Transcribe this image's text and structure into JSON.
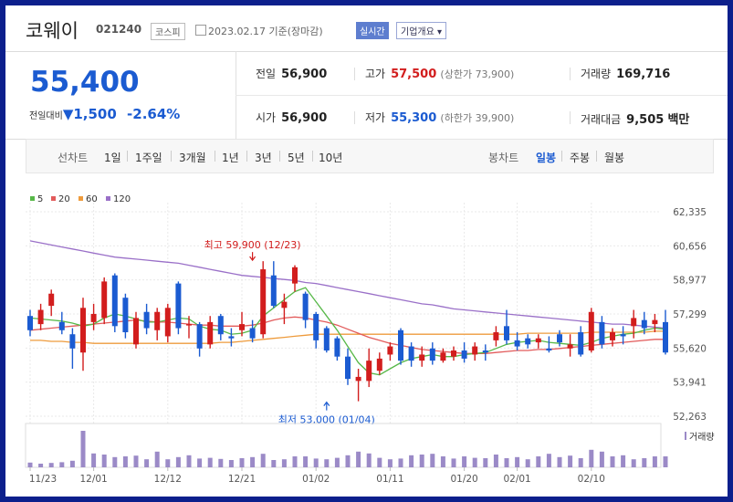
{
  "header": {
    "name": "코웨이",
    "code": "021240",
    "market": "코스피",
    "date": "2023.02.17 기준(장마감)",
    "realtime": "실시간",
    "overview": "기업개요"
  },
  "quote": {
    "price": "55,400",
    "change_label": "전일대비",
    "change": "1,500",
    "change_pct": "-2.64%",
    "prev_close": {
      "label": "전일",
      "value": "56,900"
    },
    "high": {
      "label": "고가",
      "value": "57,500",
      "limit_label": "(상한가",
      "limit_value": "73,900)"
    },
    "volume": {
      "label": "거래량",
      "value": "169,716"
    },
    "open": {
      "label": "시가",
      "value": "56,900"
    },
    "low": {
      "label": "저가",
      "value": "55,300",
      "limit_label": "(하한가",
      "limit_value": "39,900)"
    },
    "amount": {
      "label": "거래대금",
      "value": "9,505",
      "unit": "백만"
    }
  },
  "tabs": {
    "line_label": "선차트",
    "periods": [
      "1일",
      "1주일",
      "3개월",
      "1년",
      "3년",
      "5년",
      "10년"
    ],
    "candle_label": "봉차트",
    "candles": [
      "일봉",
      "주봉",
      "월봉"
    ],
    "active_candle": 0
  },
  "colors": {
    "up": "#d21d1d",
    "down": "#1b5bd1",
    "ma5": "#57b848",
    "ma20": "#e25b5b",
    "ma60": "#ee9b3c",
    "ma120": "#9a70c8",
    "volume": "#9b8ac7"
  },
  "chart_data": {
    "type": "candlestick",
    "legend": [
      {
        "name": "5",
        "color": "#57b848"
      },
      {
        "name": "20",
        "color": "#e25b5b"
      },
      {
        "name": "60",
        "color": "#ee9b3c"
      },
      {
        "name": "120",
        "color": "#9a70c8"
      }
    ],
    "y_ticks": [
      "62,335",
      "60,656",
      "58,977",
      "57,299",
      "55,620",
      "53,941",
      "52,263"
    ],
    "ylim": [
      52263,
      62335
    ],
    "x_ticks": [
      {
        "label": "11/23",
        "index": 0
      },
      {
        "label": "12/01",
        "index": 6
      },
      {
        "label": "12/12",
        "index": 13
      },
      {
        "label": "12/21",
        "index": 20
      },
      {
        "label": "01/02",
        "index": 27
      },
      {
        "label": "01/11",
        "index": 34
      },
      {
        "label": "01/20",
        "index": 41
      },
      {
        "label": "02/01",
        "index": 46
      },
      {
        "label": "02/10",
        "index": 53
      }
    ],
    "annotations": {
      "high": {
        "text": "최고 59,900 (12/23)",
        "index": 21,
        "value": 59900
      },
      "low": {
        "text": "최저 53,000 (01/04)",
        "index": 28,
        "value": 53000
      }
    },
    "volume_label": "거래량",
    "candles": [
      {
        "o": 57200,
        "h": 57500,
        "l": 56200,
        "c": 56500
      },
      {
        "o": 56800,
        "h": 57800,
        "l": 56500,
        "c": 57500
      },
      {
        "o": 57700,
        "h": 58500,
        "l": 57200,
        "c": 58300
      },
      {
        "o": 56900,
        "h": 57400,
        "l": 56300,
        "c": 56500
      },
      {
        "o": 56300,
        "h": 56600,
        "l": 54600,
        "c": 55600
      },
      {
        "o": 55400,
        "h": 58100,
        "l": 54500,
        "c": 57600
      },
      {
        "o": 56900,
        "h": 57800,
        "l": 56500,
        "c": 57300
      },
      {
        "o": 57100,
        "h": 59100,
        "l": 56800,
        "c": 58900
      },
      {
        "o": 59200,
        "h": 59300,
        "l": 56400,
        "c": 56700
      },
      {
        "o": 58100,
        "h": 58300,
        "l": 56100,
        "c": 56400
      },
      {
        "o": 55800,
        "h": 57400,
        "l": 55600,
        "c": 57100
      },
      {
        "o": 57400,
        "h": 57800,
        "l": 56300,
        "c": 56600
      },
      {
        "o": 56500,
        "h": 57600,
        "l": 56000,
        "c": 57400
      },
      {
        "o": 56200,
        "h": 57800,
        "l": 55900,
        "c": 57600
      },
      {
        "o": 58800,
        "h": 58900,
        "l": 56300,
        "c": 56600
      },
      {
        "o": 56800,
        "h": 57200,
        "l": 56100,
        "c": 56800
      },
      {
        "o": 56800,
        "h": 56900,
        "l": 55200,
        "c": 55600
      },
      {
        "o": 55800,
        "h": 57200,
        "l": 55600,
        "c": 56900
      },
      {
        "o": 57200,
        "h": 57300,
        "l": 56000,
        "c": 56300
      },
      {
        "o": 56200,
        "h": 56600,
        "l": 55700,
        "c": 56100
      },
      {
        "o": 56500,
        "h": 57400,
        "l": 56200,
        "c": 56800
      },
      {
        "o": 56600,
        "h": 57000,
        "l": 55900,
        "c": 56100
      },
      {
        "o": 56300,
        "h": 59900,
        "l": 56100,
        "c": 59500
      },
      {
        "o": 59200,
        "h": 59900,
        "l": 57600,
        "c": 57700
      },
      {
        "o": 57600,
        "h": 58300,
        "l": 56800,
        "c": 57900
      },
      {
        "o": 58800,
        "h": 59700,
        "l": 58400,
        "c": 59600
      },
      {
        "o": 58300,
        "h": 58400,
        "l": 56600,
        "c": 57000
      },
      {
        "o": 57300,
        "h": 57400,
        "l": 55600,
        "c": 56000
      },
      {
        "o": 56600,
        "h": 56700,
        "l": 55400,
        "c": 55500
      },
      {
        "o": 56100,
        "h": 56200,
        "l": 55000,
        "c": 55200
      },
      {
        "o": 55200,
        "h": 55600,
        "l": 53800,
        "c": 54100
      },
      {
        "o": 54000,
        "h": 54600,
        "l": 53000,
        "c": 54200
      },
      {
        "o": 54000,
        "h": 55600,
        "l": 53700,
        "c": 55000
      },
      {
        "o": 54500,
        "h": 55400,
        "l": 54300,
        "c": 55100
      },
      {
        "o": 55300,
        "h": 55900,
        "l": 55000,
        "c": 55700
      },
      {
        "o": 56500,
        "h": 56600,
        "l": 54800,
        "c": 55000
      },
      {
        "o": 55700,
        "h": 55900,
        "l": 54700,
        "c": 55000
      },
      {
        "o": 55000,
        "h": 55700,
        "l": 54700,
        "c": 55300
      },
      {
        "o": 55600,
        "h": 55900,
        "l": 54800,
        "c": 55000
      },
      {
        "o": 55000,
        "h": 55600,
        "l": 54900,
        "c": 55400
      },
      {
        "o": 55200,
        "h": 55700,
        "l": 55000,
        "c": 55500
      },
      {
        "o": 55500,
        "h": 55900,
        "l": 54900,
        "c": 55100
      },
      {
        "o": 55300,
        "h": 55900,
        "l": 55000,
        "c": 55700
      },
      {
        "o": 55500,
        "h": 55800,
        "l": 55000,
        "c": 55400
      },
      {
        "o": 56000,
        "h": 56700,
        "l": 55700,
        "c": 56400
      },
      {
        "o": 56700,
        "h": 57500,
        "l": 55800,
        "c": 56000
      },
      {
        "o": 56000,
        "h": 56400,
        "l": 55500,
        "c": 55700
      },
      {
        "o": 56100,
        "h": 56300,
        "l": 55600,
        "c": 55800
      },
      {
        "o": 55900,
        "h": 56300,
        "l": 55600,
        "c": 56100
      },
      {
        "o": 55600,
        "h": 56200,
        "l": 55400,
        "c": 55500
      },
      {
        "o": 56300,
        "h": 56500,
        "l": 55700,
        "c": 55900
      },
      {
        "o": 55600,
        "h": 56300,
        "l": 55200,
        "c": 55800
      },
      {
        "o": 56400,
        "h": 56700,
        "l": 55200,
        "c": 55300
      },
      {
        "o": 55500,
        "h": 57600,
        "l": 55400,
        "c": 57400
      },
      {
        "o": 56900,
        "h": 57200,
        "l": 55600,
        "c": 55800
      },
      {
        "o": 56000,
        "h": 56600,
        "l": 55700,
        "c": 56400
      },
      {
        "o": 56300,
        "h": 56700,
        "l": 55800,
        "c": 56200
      },
      {
        "o": 56700,
        "h": 57500,
        "l": 56100,
        "c": 57100
      },
      {
        "o": 57000,
        "h": 57400,
        "l": 56300,
        "c": 56600
      },
      {
        "o": 56800,
        "h": 57300,
        "l": 56400,
        "c": 57000
      },
      {
        "o": 56900,
        "h": 57500,
        "l": 55300,
        "c": 55400
      }
    ],
    "volumes": [
      0.13,
      0.1,
      0.12,
      0.14,
      0.18,
      1.0,
      0.38,
      0.35,
      0.28,
      0.3,
      0.32,
      0.22,
      0.43,
      0.22,
      0.28,
      0.33,
      0.24,
      0.26,
      0.23,
      0.2,
      0.25,
      0.28,
      0.37,
      0.2,
      0.22,
      0.3,
      0.3,
      0.24,
      0.22,
      0.26,
      0.33,
      0.43,
      0.38,
      0.26,
      0.22,
      0.24,
      0.33,
      0.35,
      0.37,
      0.3,
      0.24,
      0.3,
      0.26,
      0.25,
      0.35,
      0.25,
      0.28,
      0.22,
      0.3,
      0.37,
      0.28,
      0.32,
      0.25,
      0.48,
      0.43,
      0.3,
      0.33,
      0.22,
      0.25,
      0.3,
      0.3
    ],
    "ma5": [
      57100,
      57050,
      57000,
      56950,
      56850,
      56700,
      56800,
      57100,
      57300,
      57200,
      57050,
      56900,
      56900,
      57000,
      57100,
      57050,
      56700,
      56550,
      56500,
      56300,
      56350,
      56500,
      57200,
      57600,
      58000,
      58400,
      58600,
      57900,
      57200,
      56500,
      55700,
      54900,
      54400,
      54300,
      54600,
      54900,
      55100,
      55200,
      55300,
      55200,
      55200,
      55300,
      55350,
      55400,
      55600,
      55800,
      55900,
      55950,
      56000,
      55900,
      55850,
      55800,
      55750,
      55900,
      56100,
      56200,
      56300,
      56350,
      56500,
      56600,
      56550
    ],
    "ma20": [
      56500,
      56550,
      56600,
      56650,
      56700,
      56750,
      56800,
      56850,
      56900,
      56950,
      57000,
      56950,
      56900,
      56900,
      56850,
      56800,
      56750,
      56750,
      56700,
      56700,
      56700,
      56750,
      56850,
      57000,
      57100,
      57150,
      57100,
      57000,
      56900,
      56750,
      56550,
      56350,
      56150,
      56000,
      55850,
      55750,
      55650,
      55550,
      55500,
      55450,
      55400,
      55350,
      55350,
      55350,
      55400,
      55450,
      55500,
      55500,
      55550,
      55550,
      55600,
      55650,
      55700,
      55750,
      55800,
      55850,
      55900,
      55950,
      56000,
      56050,
      56050
    ],
    "ma60": [
      56000,
      56000,
      55950,
      55950,
      55900,
      55900,
      55850,
      55850,
      55850,
      55850,
      55850,
      55850,
      55850,
      55850,
      55850,
      55850,
      55850,
      55850,
      55900,
      55900,
      55950,
      56000,
      56050,
      56100,
      56150,
      56200,
      56250,
      56300,
      56300,
      56300,
      56300,
      56300,
      56300,
      56300,
      56300,
      56300,
      56300,
      56300,
      56300,
      56300,
      56300,
      56300,
      56300,
      56300,
      56300,
      56300,
      56300,
      56350,
      56350,
      56350,
      56350,
      56350,
      56350,
      56400,
      56400,
      56400,
      56400,
      56400,
      56400,
      56450,
      56450
    ],
    "ma120": [
      60900,
      60800,
      60700,
      60600,
      60500,
      60400,
      60300,
      60200,
      60100,
      60050,
      60000,
      59950,
      59900,
      59850,
      59800,
      59700,
      59600,
      59500,
      59400,
      59300,
      59200,
      59150,
      59100,
      59050,
      59000,
      58950,
      58850,
      58800,
      58700,
      58600,
      58500,
      58400,
      58300,
      58200,
      58100,
      58000,
      57900,
      57800,
      57750,
      57650,
      57550,
      57500,
      57450,
      57400,
      57350,
      57300,
      57250,
      57200,
      57150,
      57100,
      57050,
      57000,
      56950,
      56900,
      56850,
      56800,
      56800,
      56750,
      56700,
      56650,
      56600
    ]
  }
}
